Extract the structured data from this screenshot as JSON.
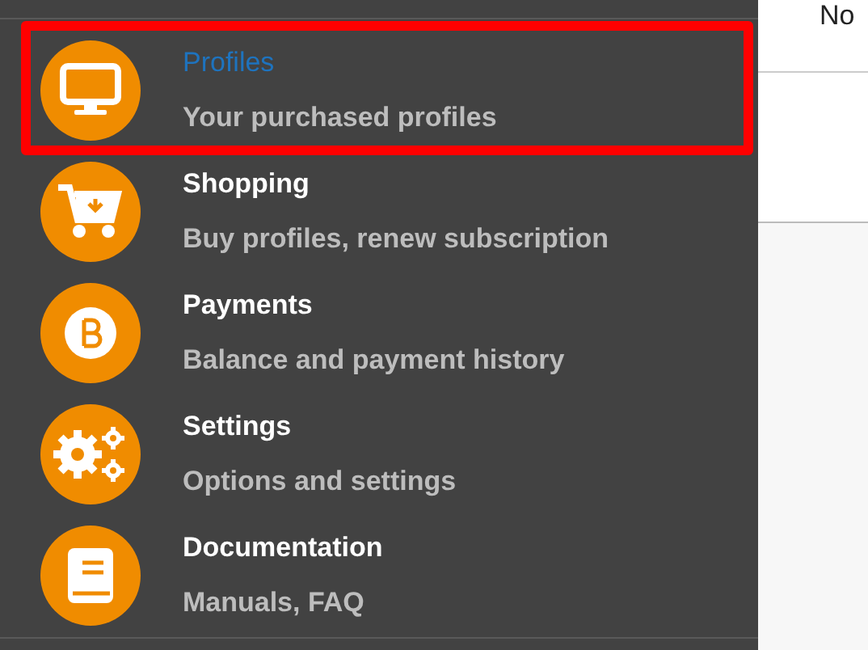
{
  "menu": {
    "items": [
      {
        "kind": "monitor",
        "title": "Profiles",
        "subtitle": "Your purchased profiles",
        "selected": true
      },
      {
        "kind": "cart",
        "title": "Shopping",
        "subtitle": "Buy profiles, renew subscription",
        "selected": false
      },
      {
        "kind": "coin",
        "title": "Payments",
        "subtitle": "Balance and payment history",
        "selected": false
      },
      {
        "kind": "gears",
        "title": "Settings",
        "subtitle": "Options and settings",
        "selected": false
      },
      {
        "kind": "book",
        "title": "Documentation",
        "subtitle": "Manuals, FAQ",
        "selected": false
      }
    ]
  },
  "content": {
    "column_1": "No"
  }
}
